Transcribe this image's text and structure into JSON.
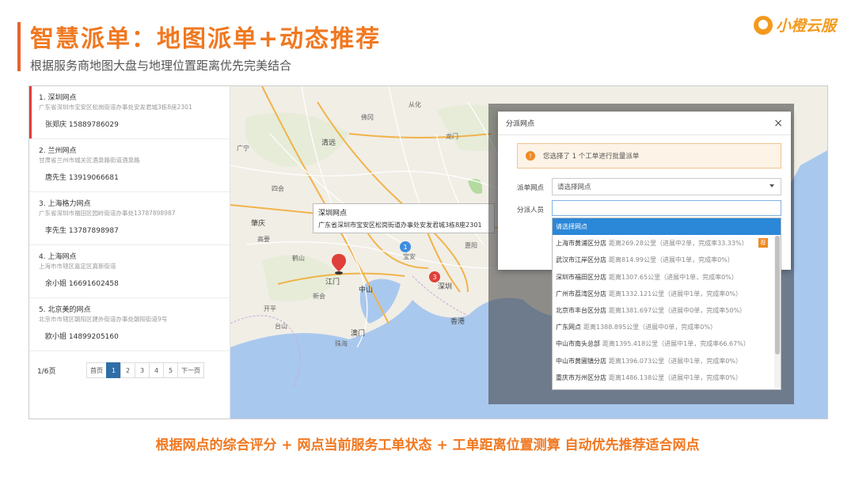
{
  "header": {
    "title": "智慧派单：地图派单+动态推荐",
    "subtitle": "根据服务商地图大盘与地理位置距离优先完美结合",
    "logo_text": "小橙云服",
    "accent_color": "#f07820"
  },
  "outlets": [
    {
      "name": "1. 深圳网点",
      "address": "广东省深圳市宝安区松岗街道办事处安发君城3栋8座2301",
      "contact": "张郑庆  15889786029",
      "active": true
    },
    {
      "name": "2. 兰州网点",
      "address": "甘肃省兰州市城关区酒泉路街道酒泉路",
      "contact": "唐先生  13919066681",
      "active": false
    },
    {
      "name": "3. 上海格力网点",
      "address": "广东省深圳市福田区园岭街道办事处13787898987",
      "contact": "李先生  13787898987",
      "active": false
    },
    {
      "name": "4. 上海网点",
      "address": "上海市市辖区嘉定区真新街道",
      "contact": "余小姐  16691602458",
      "active": false
    },
    {
      "name": "5. 北京美的网点",
      "address": "北京市市辖区朝阳区建外街道办事处朝阳街道9号",
      "contact": "欧小姐  14899205160",
      "active": false
    }
  ],
  "pagination": {
    "total_label": "1/6页",
    "first_label": "首页",
    "pages": [
      "1",
      "2",
      "3",
      "4",
      "5"
    ],
    "current_page": "1",
    "next_label": "下一页"
  },
  "map": {
    "places": [
      "清远",
      "佛冈",
      "从化",
      "龙门",
      "广宁",
      "四会",
      "肇庆",
      "高要",
      "鹤山",
      "江门",
      "中山",
      "开平",
      "台山",
      "深圳",
      "香港",
      "澳门",
      "珠海",
      "惠阳",
      "宝安",
      "新会"
    ],
    "popup_title": "深圳网点",
    "popup_address": "广东省深圳市宝安区松岗街道办事处安发君城3栋8座2301",
    "cluster_blue": "1",
    "cluster_red": "3"
  },
  "dialog": {
    "title": "分派网点",
    "close_icon": "×",
    "notice": "您选择了 1 个工单进行批量派单",
    "outlet_label": "派单网点",
    "outlet_placeholder": "请选择网点",
    "staff_label": "分派人员"
  },
  "dropdown": {
    "options": [
      {
        "name": "请选择网点",
        "dist": "",
        "highlight": true,
        "tag": ""
      },
      {
        "name": "上海市黄浦区分店",
        "dist": "距离269.28公里（进展中2单，完成率33.33%）",
        "highlight": false,
        "tag": "荐"
      },
      {
        "name": "武汉市江岸区分店",
        "dist": "距离814.99公里（进展中1单，完成率0%）",
        "highlight": false,
        "tag": ""
      },
      {
        "name": "深圳市福田区分店",
        "dist": "距离1307.65公里（进展中1单，完成率0%）",
        "highlight": false,
        "tag": ""
      },
      {
        "name": "广州市荔湾区分店",
        "dist": "距离1332.121公里（进展中1单，完成率0%）",
        "highlight": false,
        "tag": ""
      },
      {
        "name": "北京市丰台区分店",
        "dist": "距离1381.697公里（进展中0单，完成率50%）",
        "highlight": false,
        "tag": ""
      },
      {
        "name": "广东网点",
        "dist": "距离1388.895公里（进展中0单，完成率0%）",
        "highlight": false,
        "tag": ""
      },
      {
        "name": "中山市南头总部",
        "dist": "距离1395.418公里（进展中1单，完成率66.67%）",
        "highlight": false,
        "tag": ""
      },
      {
        "name": "中山市黄圃镇分店",
        "dist": "距离1396.073公里（进展中1单，完成率0%）",
        "highlight": false,
        "tag": ""
      },
      {
        "name": "重庆市万州区分店",
        "dist": "距离1486.138公里（进展中1单，完成率0%）",
        "highlight": false,
        "tag": ""
      }
    ]
  },
  "footer": {
    "banner": "根据网点的综合评分 + 网点当前服务工单状态 + 工单距离位置测算 自动优先推荐适合网点"
  }
}
